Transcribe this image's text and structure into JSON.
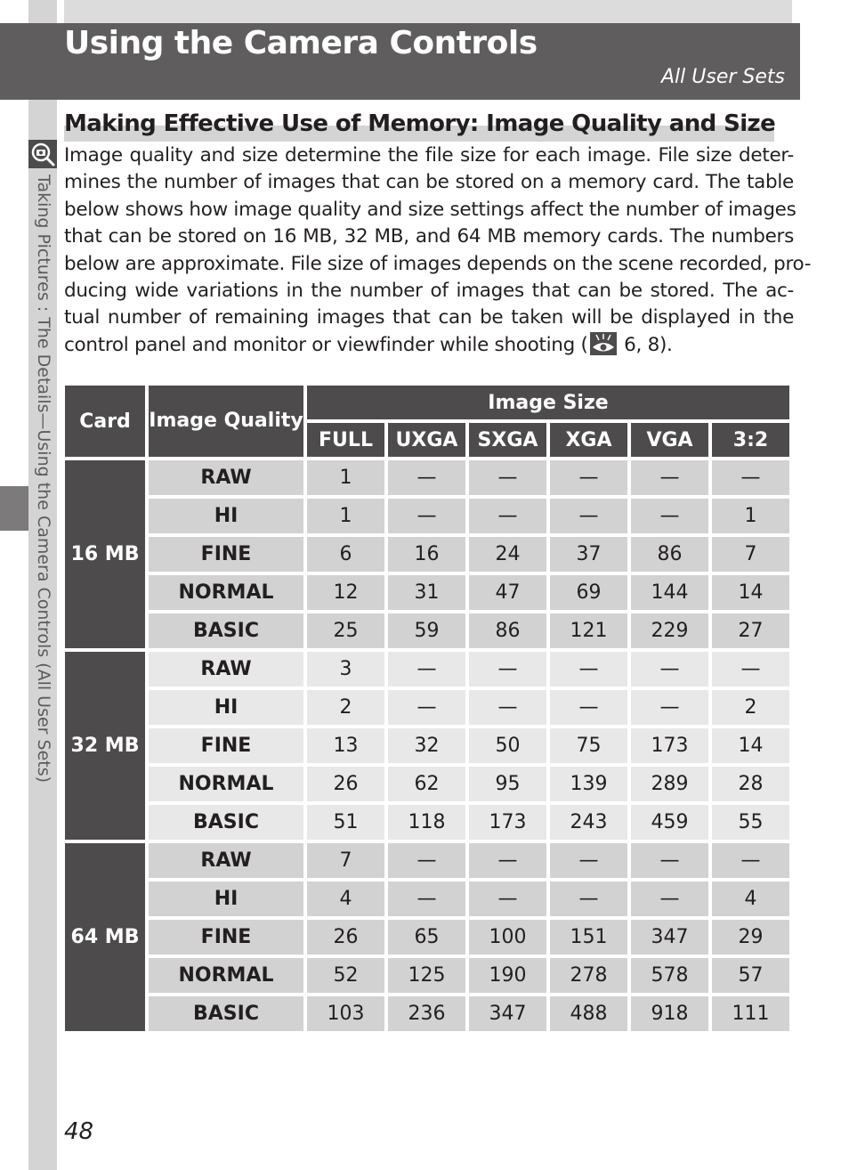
{
  "header": {
    "title": "Using the Camera Controls",
    "subtitle": "All User Sets"
  },
  "sidebar": {
    "icon": "magnifier-camera-icon",
    "text": "Taking Pictures : The Details—Using the Camera Controls (All User Sets)"
  },
  "section": {
    "heading": "Making Effective Use of Memory: Image Quality and Size",
    "body_lines": [
      "Image quality and size determine the file size for each image. File size deter-",
      "mines the number of images that can be stored on a memory card. The table",
      "below shows how image quality and size settings affect the number of images",
      "that can be stored on 16 MB, 32 MB, and 64 MB memory cards. The numbers",
      "below are approximate. File size of images depends on the scene recorded, pro-",
      "ducing wide variations in the number of images that can be stored.  The ac-",
      "tual number of remaining images that can be taken will be displayed in the"
    ],
    "body_last_prefix": "control panel and monitor or viewfinder while shooting (",
    "body_last_icon": "eye-reference-icon",
    "body_last_suffix": " 6, 8)."
  },
  "table": {
    "headers": {
      "card": "Card",
      "quality": "Image Quality",
      "image_size": "Image Size",
      "sizes": [
        "FULL",
        "UXGA",
        "SXGA",
        "XGA",
        "VGA",
        "3:2"
      ]
    },
    "groups": [
      {
        "card": "16 MB",
        "rows": [
          {
            "quality": "RAW",
            "values": [
              "1",
              "—",
              "—",
              "—",
              "—",
              "—"
            ]
          },
          {
            "quality": "HI",
            "values": [
              "1",
              "—",
              "—",
              "—",
              "—",
              "1"
            ]
          },
          {
            "quality": "FINE",
            "values": [
              "6",
              "16",
              "24",
              "37",
              "86",
              "7"
            ]
          },
          {
            "quality": "NORMAL",
            "values": [
              "12",
              "31",
              "47",
              "69",
              "144",
              "14"
            ]
          },
          {
            "quality": "BASIC",
            "values": [
              "25",
              "59",
              "86",
              "121",
              "229",
              "27"
            ]
          }
        ]
      },
      {
        "card": "32 MB",
        "rows": [
          {
            "quality": "RAW",
            "values": [
              "3",
              "—",
              "—",
              "—",
              "—",
              "—"
            ]
          },
          {
            "quality": "HI",
            "values": [
              "2",
              "—",
              "—",
              "—",
              "—",
              "2"
            ]
          },
          {
            "quality": "FINE",
            "values": [
              "13",
              "32",
              "50",
              "75",
              "173",
              "14"
            ]
          },
          {
            "quality": "NORMAL",
            "values": [
              "26",
              "62",
              "95",
              "139",
              "289",
              "28"
            ]
          },
          {
            "quality": "BASIC",
            "values": [
              "51",
              "118",
              "173",
              "243",
              "459",
              "55"
            ]
          }
        ]
      },
      {
        "card": "64 MB",
        "rows": [
          {
            "quality": "RAW",
            "values": [
              "7",
              "—",
              "—",
              "—",
              "—",
              "—"
            ]
          },
          {
            "quality": "HI",
            "values": [
              "4",
              "—",
              "—",
              "—",
              "—",
              "4"
            ]
          },
          {
            "quality": "FINE",
            "values": [
              "26",
              "65",
              "100",
              "151",
              "347",
              "29"
            ]
          },
          {
            "quality": "NORMAL",
            "values": [
              "52",
              "125",
              "190",
              "278",
              "578",
              "57"
            ]
          },
          {
            "quality": "BASIC",
            "values": [
              "103",
              "236",
              "347",
              "488",
              "918",
              "111"
            ]
          }
        ]
      }
    ]
  },
  "footer": {
    "page_number": "48"
  }
}
